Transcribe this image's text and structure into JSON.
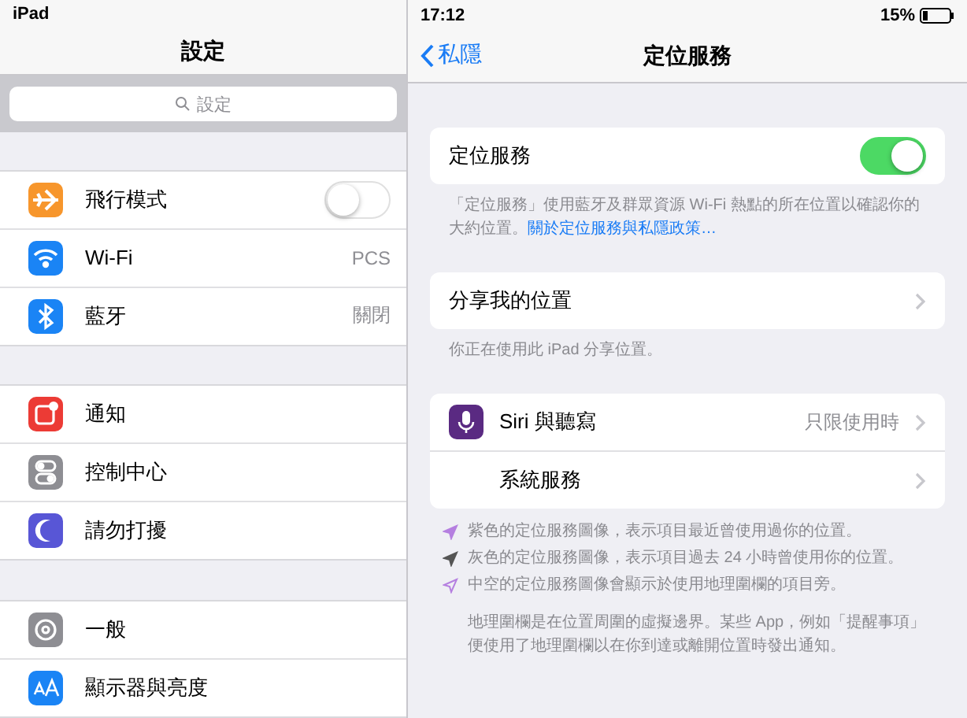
{
  "status_bar": {
    "device": "iPad",
    "time": "17:12",
    "battery": "15%"
  },
  "sidebar": {
    "title": "設定",
    "search": {
      "placeholder": "設定"
    },
    "groups": [
      [
        {
          "label": "飛行模式",
          "kind": "toggle",
          "on": false,
          "color": "#f7962c"
        },
        {
          "label": "Wi-Fi",
          "kind": "value",
          "value": "PCS",
          "color": "#1a84f5"
        },
        {
          "label": "藍牙",
          "kind": "value",
          "value": "關閉",
          "color": "#1a84f5"
        }
      ],
      [
        {
          "label": "通知",
          "kind": "plain",
          "color": "#ec3b35"
        },
        {
          "label": "控制中心",
          "kind": "plain",
          "color": "#8e8e93"
        },
        {
          "label": "請勿打擾",
          "kind": "plain",
          "color": "#5856d6"
        }
      ],
      [
        {
          "label": "一般",
          "kind": "plain",
          "color": "#8e8e93"
        },
        {
          "label": "顯示器與亮度",
          "kind": "plain",
          "color": "#1a84f5"
        }
      ]
    ]
  },
  "detail": {
    "back": "私隱",
    "title": "定位服務",
    "location_toggle": {
      "label": "定位服務",
      "on": true
    },
    "location_note": {
      "text": "「定位服務」使用藍牙及群眾資源 Wi-Fi 熱點的所在位置以確認你的大約位置。",
      "link": "關於定位服務與私隱政策…"
    },
    "share": {
      "label": "分享我的位置",
      "note": "你正在使用此 iPad 分享位置。"
    },
    "services": [
      {
        "label": "Siri 與聽寫",
        "value": "只限使用時",
        "has_icon": true
      },
      {
        "label": "系統服務",
        "has_icon": false
      }
    ],
    "legend": [
      {
        "text": "紫色的定位服務圖像，表示項目最近曾使用過你的位置。",
        "color": "#b57fe0",
        "hollow": false
      },
      {
        "text": "灰色的定位服務圖像，表示項目過去 24 小時曾使用你的位置。",
        "color": "#555555",
        "hollow": false
      },
      {
        "text": "中空的定位服務圖像會顯示於使用地理圍欄的項目旁。",
        "color": "#b57fe0",
        "hollow": true
      }
    ],
    "geofence_note": "地理圍欄是在位置周圍的虛擬邊界。某些 App，例如「提醒事項」便使用了地理圍欄以在你到達或離開位置時發出通知。"
  }
}
